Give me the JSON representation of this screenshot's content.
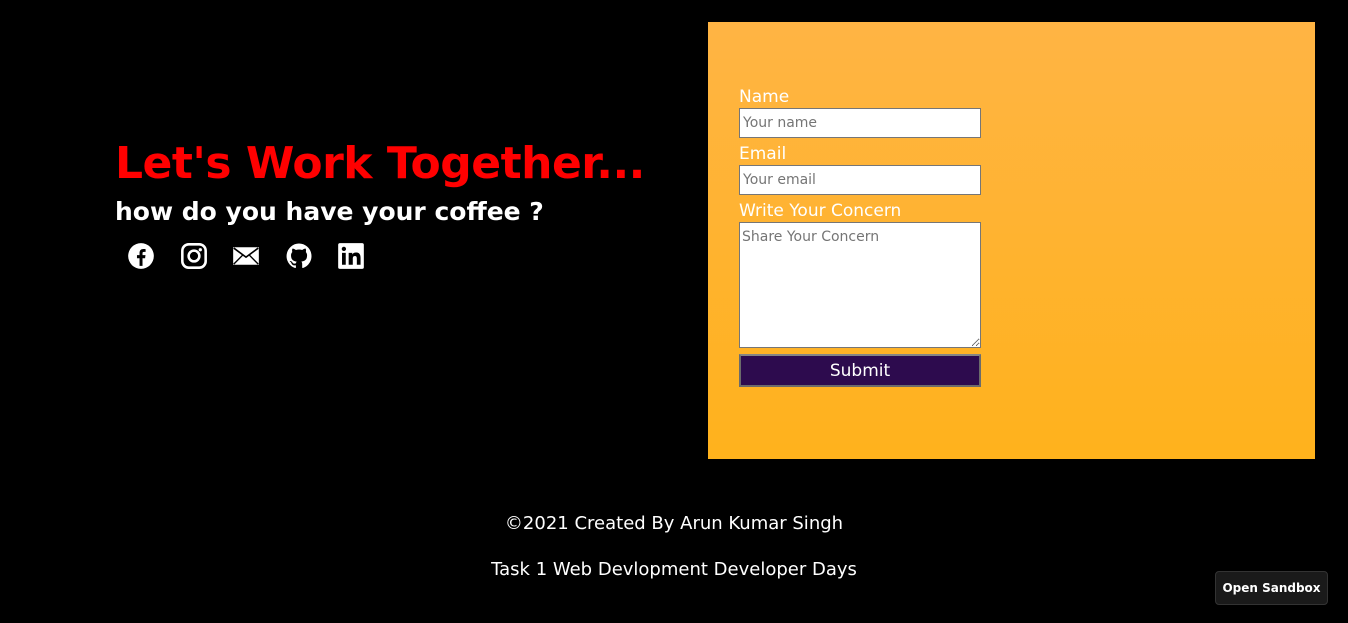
{
  "hero": {
    "title": "Let's Work Together...",
    "subtitle": "how do you have your coffee ?",
    "title_color": "#ff0000",
    "social_icons": [
      "facebook-icon",
      "instagram-icon",
      "mail-icon",
      "github-icon",
      "linkedin-icon"
    ]
  },
  "form": {
    "panel_color": "#ffb32e",
    "name_label": "Name",
    "name_placeholder": "Your name",
    "email_label": "Email",
    "email_placeholder": "Your email",
    "concern_label": "Write Your Concern",
    "concern_placeholder": "Share Your Concern",
    "submit_label": "Submit",
    "submit_color": "#2d0b4e"
  },
  "footer": {
    "credit": "©2021 Created By Arun Kumar Singh",
    "task": "Task 1 Web Devlopment Developer Days"
  },
  "sandbox": {
    "button_label": "Open Sandbox"
  }
}
